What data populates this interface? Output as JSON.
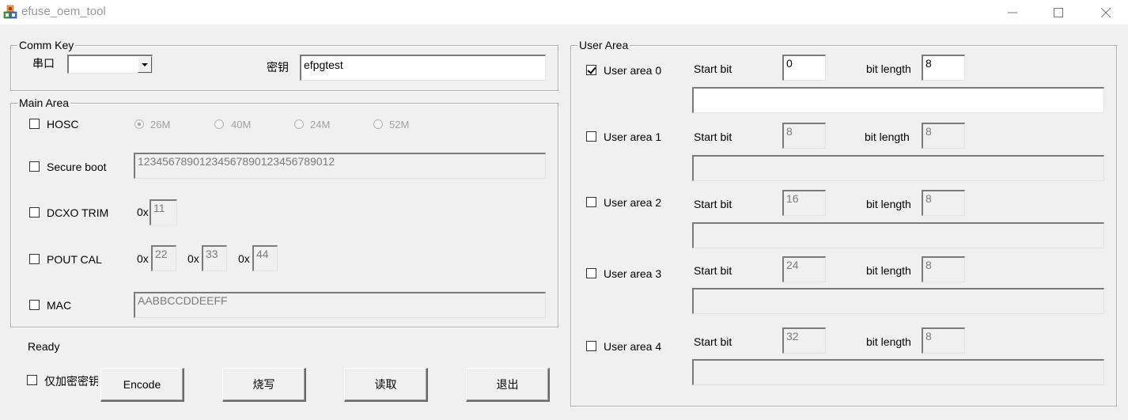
{
  "window": {
    "title": "efuse_oem_tool",
    "minimize_icon": "minimize-icon",
    "maximize_icon": "maximize-icon",
    "close_icon": "close-icon"
  },
  "comm_key": {
    "group_label": "Comm  Key",
    "port_label": "串口",
    "port_value": "",
    "key_label": "密钥",
    "key_value": "efpgtest"
  },
  "main_area": {
    "group_label": "Main Area",
    "hosc": {
      "label": "HOSC",
      "checked": false,
      "options": [
        "26M",
        "40M",
        "24M",
        "52M"
      ],
      "selected": "26M"
    },
    "secure_boot": {
      "label": "Secure boot",
      "checked": false,
      "value": "12345678901234567890123456789012"
    },
    "dcxo_trim": {
      "label": "DCXO TRIM",
      "checked": false,
      "prefix": "0x",
      "value": "11"
    },
    "pout_cal": {
      "label": "POUT CAL",
      "checked": false,
      "prefix": "0x",
      "values": [
        "22",
        "33",
        "44"
      ]
    },
    "mac": {
      "label": "MAC",
      "checked": false,
      "value": "AABBCCDDEEFF"
    }
  },
  "status": "Ready",
  "bottom": {
    "encrypt_only_label": "仅加密密钥",
    "encrypt_only_checked": false,
    "buttons": {
      "encode": "Encode",
      "burn": "烧写",
      "read": "读取",
      "exit": "退出"
    }
  },
  "user_area": {
    "group_label": "User Area",
    "start_bit_label": "Start bit",
    "bit_length_label": "bit length",
    "areas": [
      {
        "label": "User area 0",
        "checked": true,
        "start_bit": "0",
        "bit_length": "8",
        "data": ""
      },
      {
        "label": "User area 1",
        "checked": false,
        "start_bit": "8",
        "bit_length": "8",
        "data": ""
      },
      {
        "label": "User area 2",
        "checked": false,
        "start_bit": "16",
        "bit_length": "8",
        "data": ""
      },
      {
        "label": "User area 3",
        "checked": false,
        "start_bit": "24",
        "bit_length": "8",
        "data": ""
      },
      {
        "label": "User area 4",
        "checked": false,
        "start_bit": "32",
        "bit_length": "8",
        "data": ""
      }
    ]
  }
}
